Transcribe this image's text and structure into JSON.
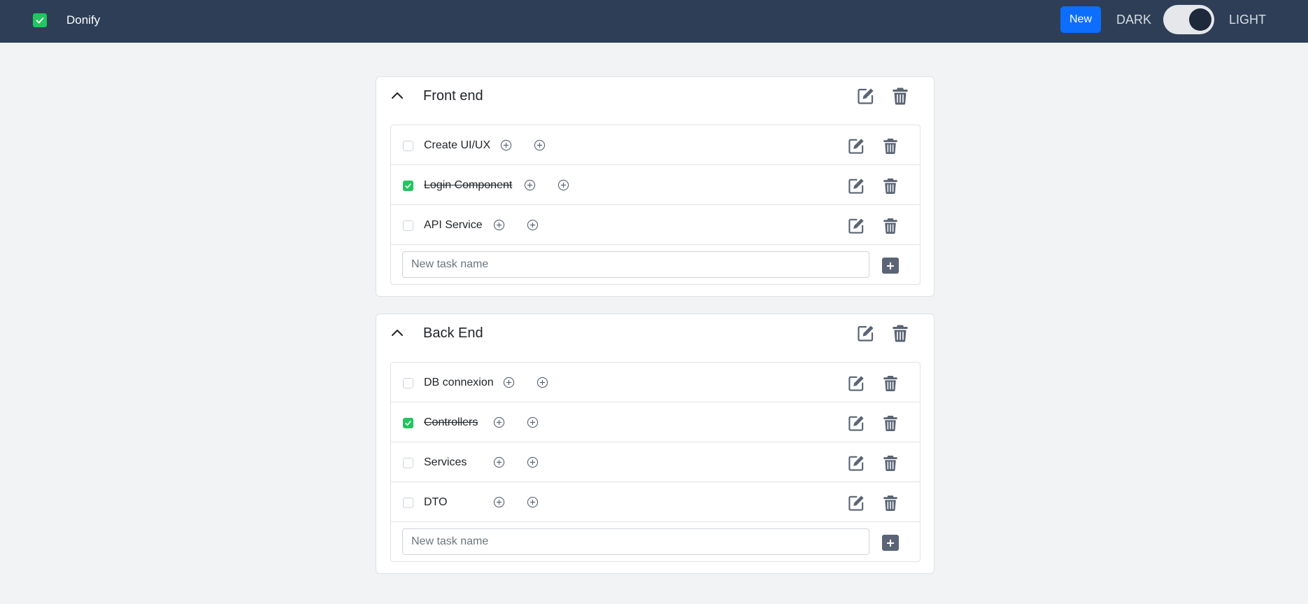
{
  "app": {
    "name": "Donify"
  },
  "header": {
    "new_label": "New",
    "dark_label": "DARK",
    "light_label": "LIGHT"
  },
  "colors": {
    "navbar": "#2d3e56",
    "accent": "#0d6efd",
    "check": "#22c55e",
    "icon": "#5a6474"
  },
  "icons": {
    "edit": "edit-icon",
    "delete": "trash-icon",
    "add": "plus-circle-icon",
    "collapse": "chevron-up-icon"
  },
  "sections": [
    {
      "title": "Front end",
      "new_task_placeholder": "New task name",
      "tasks": [
        {
          "name": "Create UI/UX",
          "done": false
        },
        {
          "name": "Login Component",
          "done": true
        },
        {
          "name": "API Service",
          "done": false
        }
      ]
    },
    {
      "title": "Back End",
      "new_task_placeholder": "New task name",
      "tasks": [
        {
          "name": "DB connexion",
          "done": false
        },
        {
          "name": "Controllers",
          "done": true
        },
        {
          "name": "Services",
          "done": false
        },
        {
          "name": "DTO",
          "done": false
        }
      ]
    }
  ]
}
